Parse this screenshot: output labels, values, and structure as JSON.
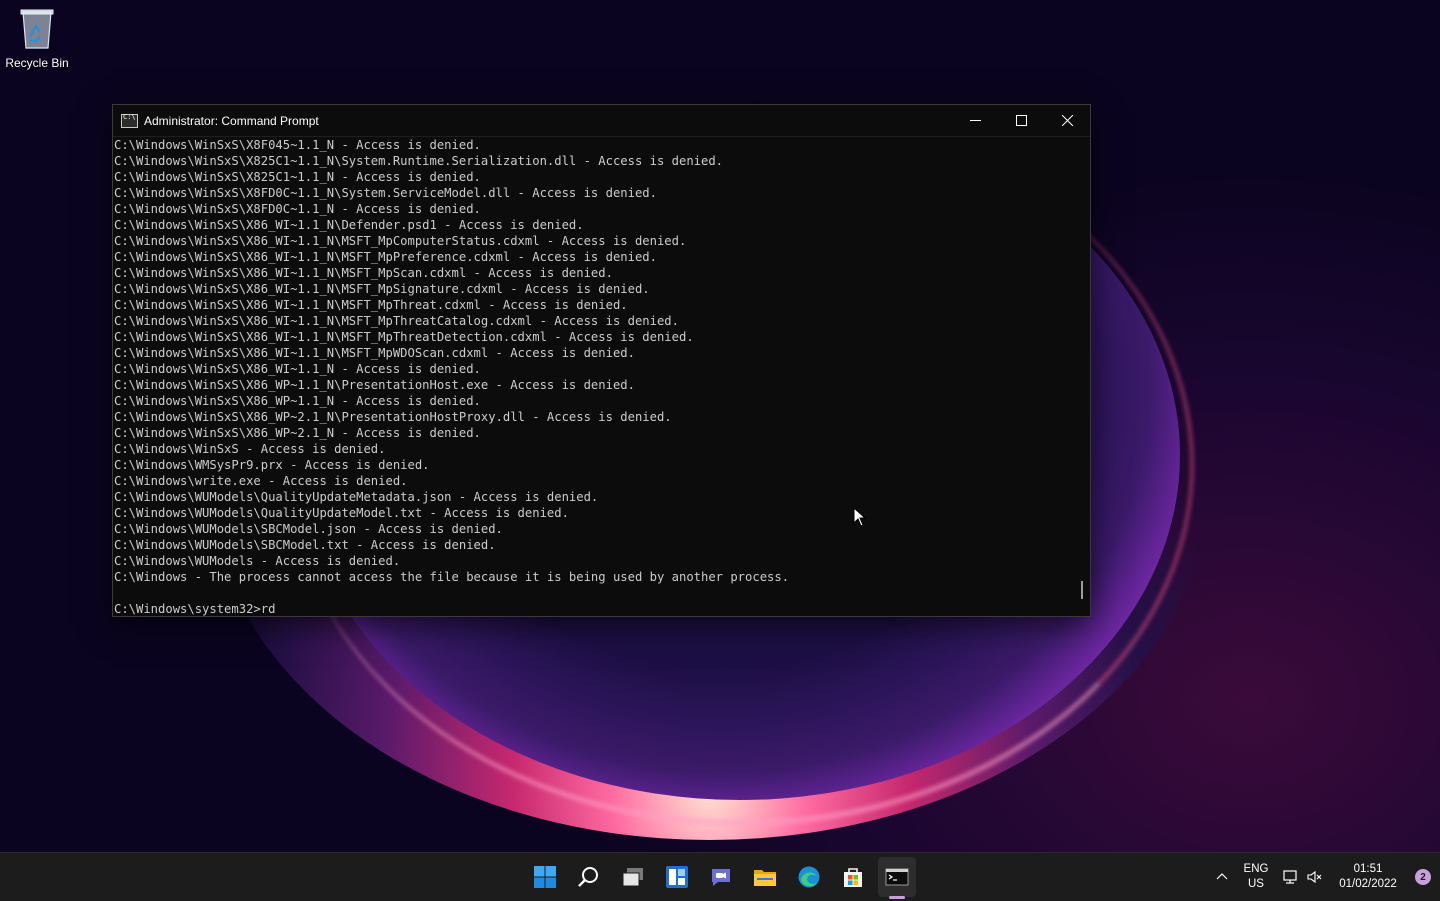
{
  "desktop": {
    "recycle_bin_label": "Recycle Bin"
  },
  "window": {
    "title": "Administrator: Command Prompt",
    "icon": "cmd-icon",
    "controls": [
      "minimize-icon",
      "maximize-icon",
      "close-icon"
    ]
  },
  "console": {
    "lines": [
      "C:\\Windows\\WinSxS\\X8F045~1.1_N - Access is denied.",
      "C:\\Windows\\WinSxS\\X825C1~1.1_N\\System.Runtime.Serialization.dll - Access is denied.",
      "C:\\Windows\\WinSxS\\X825C1~1.1_N - Access is denied.",
      "C:\\Windows\\WinSxS\\X8FD0C~1.1_N\\System.ServiceModel.dll - Access is denied.",
      "C:\\Windows\\WinSxS\\X8FD0C~1.1_N - Access is denied.",
      "C:\\Windows\\WinSxS\\X86_WI~1.1_N\\Defender.psd1 - Access is denied.",
      "C:\\Windows\\WinSxS\\X86_WI~1.1_N\\MSFT_MpComputerStatus.cdxml - Access is denied.",
      "C:\\Windows\\WinSxS\\X86_WI~1.1_N\\MSFT_MpPreference.cdxml - Access is denied.",
      "C:\\Windows\\WinSxS\\X86_WI~1.1_N\\MSFT_MpScan.cdxml - Access is denied.",
      "C:\\Windows\\WinSxS\\X86_WI~1.1_N\\MSFT_MpSignature.cdxml - Access is denied.",
      "C:\\Windows\\WinSxS\\X86_WI~1.1_N\\MSFT_MpThreat.cdxml - Access is denied.",
      "C:\\Windows\\WinSxS\\X86_WI~1.1_N\\MSFT_MpThreatCatalog.cdxml - Access is denied.",
      "C:\\Windows\\WinSxS\\X86_WI~1.1_N\\MSFT_MpThreatDetection.cdxml - Access is denied.",
      "C:\\Windows\\WinSxS\\X86_WI~1.1_N\\MSFT_MpWDOScan.cdxml - Access is denied.",
      "C:\\Windows\\WinSxS\\X86_WI~1.1_N - Access is denied.",
      "C:\\Windows\\WinSxS\\X86_WP~1.1_N\\PresentationHost.exe - Access is denied.",
      "C:\\Windows\\WinSxS\\X86_WP~1.1_N - Access is denied.",
      "C:\\Windows\\WinSxS\\X86_WP~2.1_N\\PresentationHostProxy.dll - Access is denied.",
      "C:\\Windows\\WinSxS\\X86_WP~2.1_N - Access is denied.",
      "C:\\Windows\\WinSxS - Access is denied.",
      "C:\\Windows\\WMSysPr9.prx - Access is denied.",
      "C:\\Windows\\write.exe - Access is denied.",
      "C:\\Windows\\WUModels\\QualityUpdateMetadata.json - Access is denied.",
      "C:\\Windows\\WUModels\\QualityUpdateModel.txt - Access is denied.",
      "C:\\Windows\\WUModels\\SBCModel.json - Access is denied.",
      "C:\\Windows\\WUModels\\SBCModel.txt - Access is denied.",
      "C:\\Windows\\WUModels - Access is denied.",
      "C:\\Windows - The process cannot access the file because it is being used by another process.",
      "",
      "C:\\Windows\\system32>rd"
    ]
  },
  "taskbar": {
    "apps": [
      {
        "name": "start-icon"
      },
      {
        "name": "search-icon"
      },
      {
        "name": "task-view-icon"
      },
      {
        "name": "widgets-icon"
      },
      {
        "name": "chat-icon"
      },
      {
        "name": "file-explorer-icon"
      },
      {
        "name": "edge-icon"
      },
      {
        "name": "store-icon"
      },
      {
        "name": "terminal-icon",
        "active": true
      }
    ],
    "tray": {
      "lang_line1": "ENG",
      "lang_line2": "US",
      "time": "01:51",
      "date": "01/02/2022",
      "notification_count": "2"
    }
  },
  "colors": {
    "console_bg": "#0c0c0c",
    "console_text": "#cccccc",
    "taskbar_bg": "#1c1c1c",
    "accent": "#c9a0dc"
  }
}
